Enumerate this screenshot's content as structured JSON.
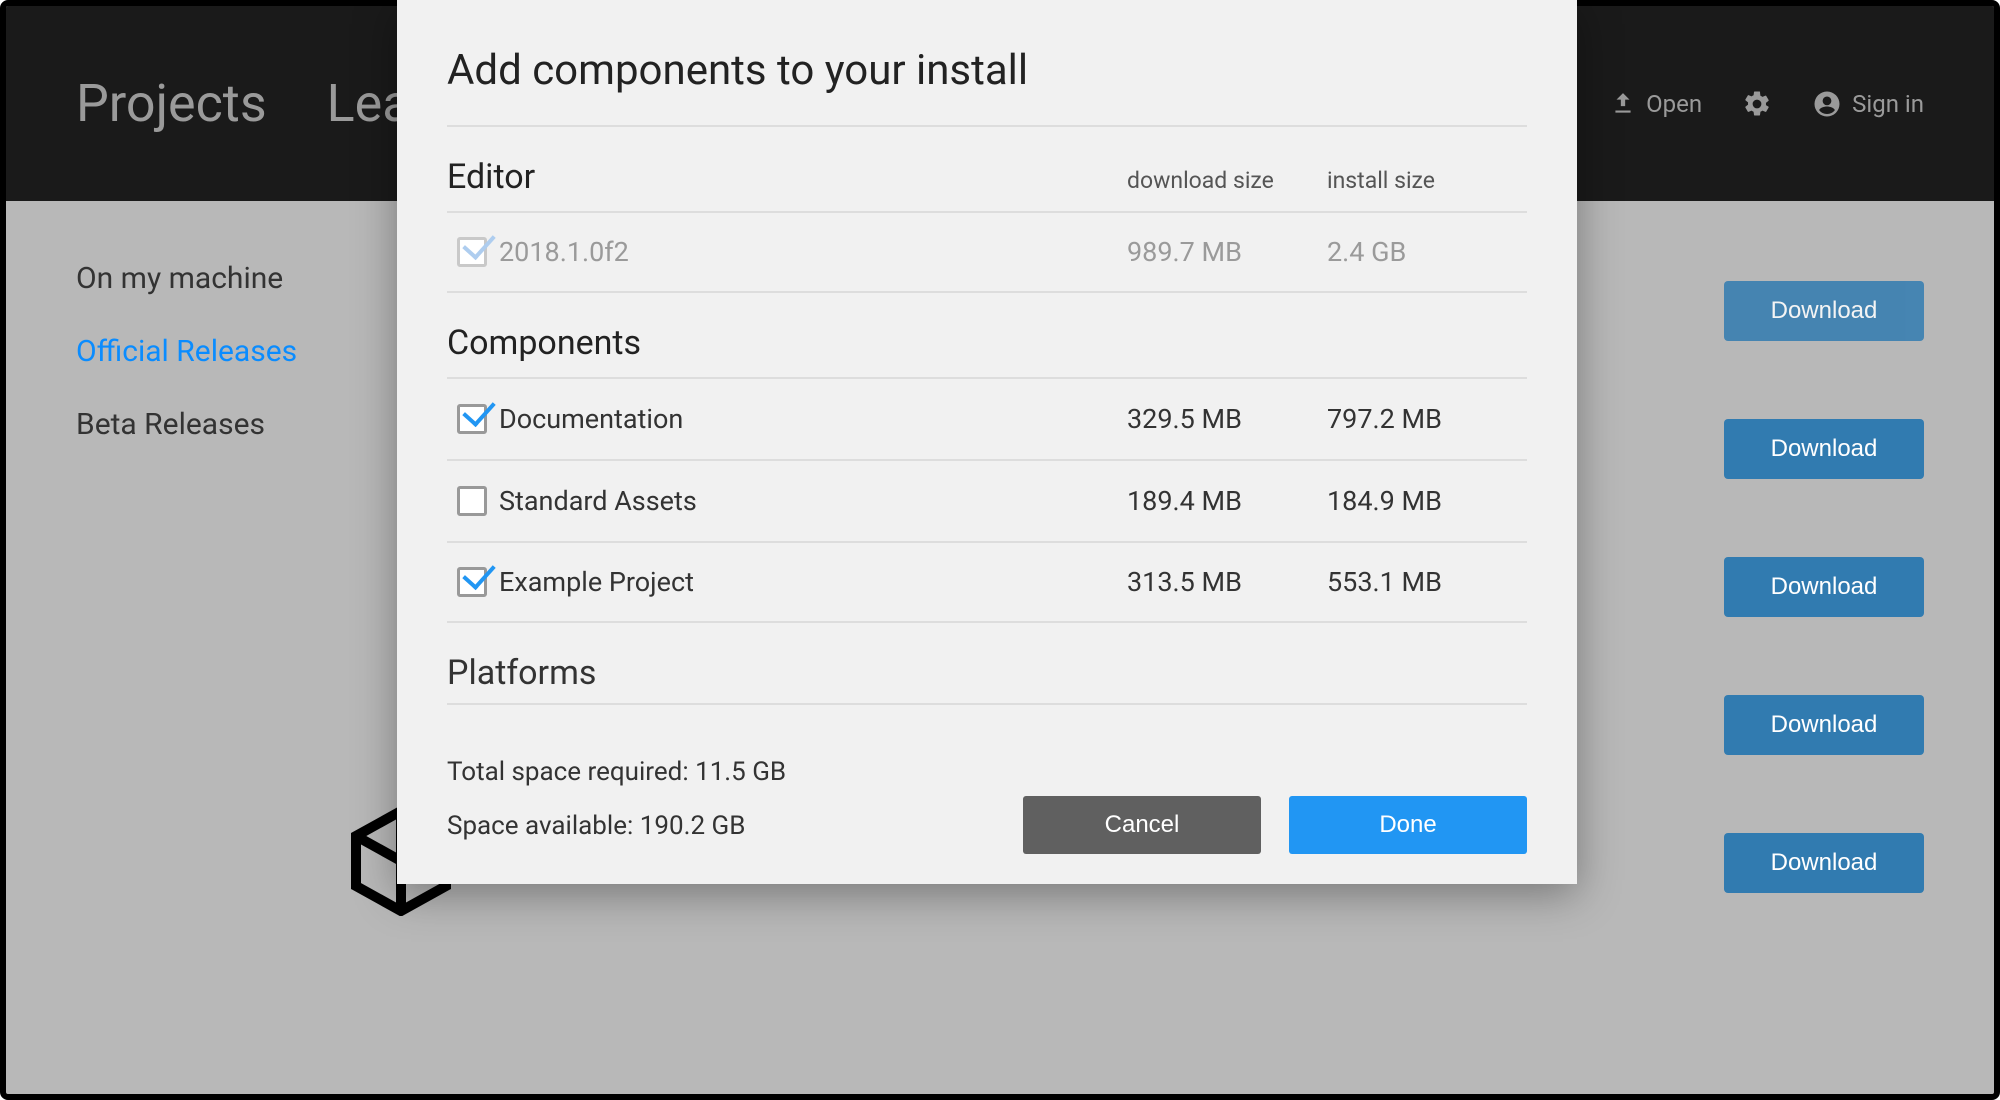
{
  "topbar": {
    "nav": [
      {
        "label": "Projects"
      },
      {
        "label": "Learn"
      }
    ],
    "actions": {
      "open_label": "Open",
      "signin_label": "Sign in"
    }
  },
  "sidebar": {
    "items": [
      {
        "label": "On my machine",
        "active": false
      },
      {
        "label": "Official Releases",
        "active": true
      },
      {
        "label": "Beta Releases",
        "active": false
      }
    ]
  },
  "downloads": {
    "button_label": "Download",
    "count": 5
  },
  "modal": {
    "title": "Add components to your install",
    "col_download": "download size",
    "col_install": "install size",
    "sections": {
      "editor": {
        "title": "Editor",
        "rows": [
          {
            "label": "2018.1.0f2",
            "download_size": "989.7 MB",
            "install_size": "2.4 GB",
            "checked": true,
            "disabled": true
          }
        ]
      },
      "components": {
        "title": "Components",
        "rows": [
          {
            "label": "Documentation",
            "download_size": "329.5 MB",
            "install_size": "797.2 MB",
            "checked": true,
            "disabled": false
          },
          {
            "label": "Standard Assets",
            "download_size": "189.4 MB",
            "install_size": "184.9 MB",
            "checked": false,
            "disabled": false
          },
          {
            "label": "Example Project",
            "download_size": "313.5 MB",
            "install_size": "553.1 MB",
            "checked": true,
            "disabled": false
          }
        ]
      },
      "platforms": {
        "title": "Platforms"
      }
    },
    "footer": {
      "total_required_label": "Total space required: ",
      "total_required_value": "11.5 GB",
      "space_available_label": "Space available: ",
      "space_available_value": "190.2 GB",
      "cancel_label": "Cancel",
      "done_label": "Done"
    }
  }
}
